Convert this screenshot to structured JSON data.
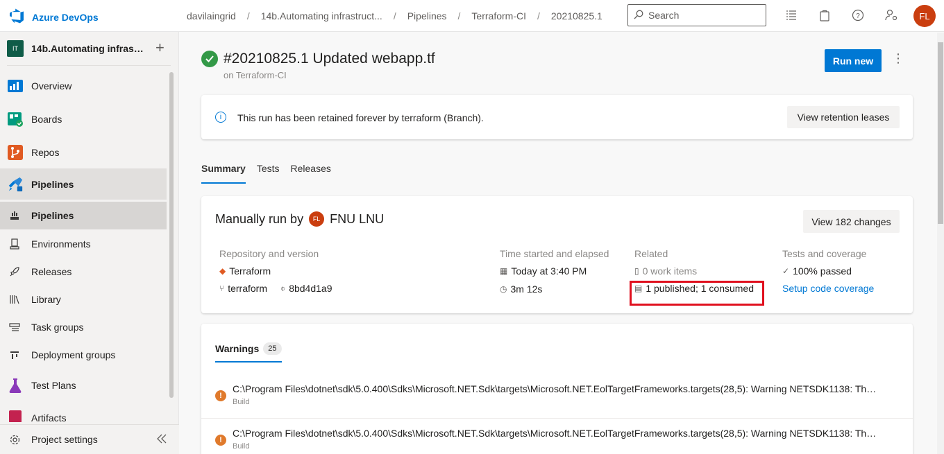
{
  "app": {
    "name": "Azure DevOps",
    "user_initials": "FL"
  },
  "breadcrumbs": [
    "davilaingrid",
    "14b.Automating infrastruct...",
    "Pipelines",
    "Terraform-CI",
    "20210825.1"
  ],
  "search": {
    "placeholder": "Search"
  },
  "project": {
    "badge": "IT",
    "name": "14b.Automating infrastructure"
  },
  "sidebar": {
    "items": [
      {
        "label": "Overview"
      },
      {
        "label": "Boards"
      },
      {
        "label": "Repos"
      },
      {
        "label": "Pipelines"
      },
      {
        "label": "Pipelines"
      },
      {
        "label": "Environments"
      },
      {
        "label": "Releases"
      },
      {
        "label": "Library"
      },
      {
        "label": "Task groups"
      },
      {
        "label": "Deployment groups"
      },
      {
        "label": "Test Plans"
      },
      {
        "label": "Artifacts"
      }
    ],
    "settings_label": "Project settings"
  },
  "run": {
    "title": "#20210825.1 Updated webapp.tf",
    "subtitle": "on Terraform-CI",
    "run_new_label": "Run new"
  },
  "retention": {
    "message": "This run has been retained forever by terraform (Branch).",
    "button": "View retention leases"
  },
  "tabs": [
    "Summary",
    "Tests",
    "Releases"
  ],
  "summary": {
    "manual_prefix": "Manually run by",
    "user_initials": "FL",
    "user_name": "FNU LNU",
    "changes_button": "View 182 changes",
    "repo_header": "Repository and version",
    "repo_name": "Terraform",
    "branch": "terraform",
    "commit": "8bd4d1a9",
    "time_header": "Time started and elapsed",
    "started": "Today at 3:40 PM",
    "elapsed": "3m 12s",
    "related_header": "Related",
    "work_items": "0 work items",
    "artifacts": "1 published; 1 consumed",
    "tests_header": "Tests and coverage",
    "passed": "100% passed",
    "coverage_link": "Setup code coverage"
  },
  "warnings": {
    "label": "Warnings",
    "count": "25",
    "rows": [
      {
        "message": "C:\\Program Files\\dotnet\\sdk\\5.0.400\\Sdks\\Microsoft.NET.Sdk\\targets\\Microsoft.NET.EolTargetFrameworks.targets(28,5): Warning NETSDK1138: The ...",
        "stage": "Build"
      },
      {
        "message": "C:\\Program Files\\dotnet\\sdk\\5.0.400\\Sdks\\Microsoft.NET.Sdk\\targets\\Microsoft.NET.EolTargetFrameworks.targets(28,5): Warning NETSDK1138: The ...",
        "stage": "Build"
      }
    ]
  },
  "colors": {
    "accent": "#0078d4",
    "success": "#339947",
    "warning": "#e07a2c",
    "highlight_box": "#e0101e",
    "avatar": "#ca3e0f"
  }
}
